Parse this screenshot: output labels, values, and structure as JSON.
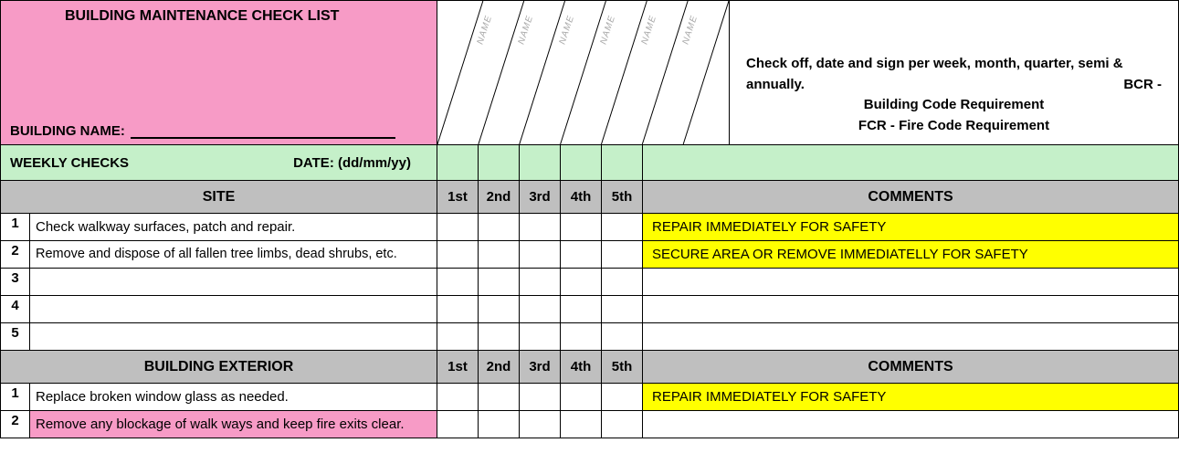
{
  "header": {
    "title": "BUILDING MAINTENANCE CHECK LIST",
    "building_name_label": "BUILDING NAME:",
    "building_name_value": "",
    "name_cols": [
      "NAME",
      "NAME",
      "NAME",
      "NAME",
      "NAME",
      "NAME"
    ],
    "instructions_line1": "Check off, date and sign per week, month, quarter, semi & annually.",
    "instructions_bcr_prefix": "BCR -",
    "instructions_bcr": "Building Code Requirement",
    "instructions_fcr": "FCR - Fire Code Requirement"
  },
  "weekly": {
    "label": "WEEKLY CHECKS",
    "date_label": "DATE: (dd/mm/yy)"
  },
  "columns": {
    "checks": [
      "1st",
      "2nd",
      "3rd",
      "4th",
      "5th"
    ],
    "comments": "COMMENTS"
  },
  "sections": [
    {
      "name": "SITE",
      "rows": [
        {
          "n": "1",
          "desc": "Check walkway surfaces, patch and repair.",
          "comment": "REPAIR IMMEDIATELY FOR SAFETY",
          "hl": "yellow"
        },
        {
          "n": "2",
          "desc": "Remove and dispose of all fallen tree limbs, dead shrubs, etc.",
          "comment": "SECURE AREA OR REMOVE IMMEDIATELLY FOR SAFETY",
          "hl": "yellow"
        },
        {
          "n": "3",
          "desc": "",
          "comment": "",
          "hl": ""
        },
        {
          "n": "4",
          "desc": "",
          "comment": "",
          "hl": ""
        },
        {
          "n": "5",
          "desc": "",
          "comment": "",
          "hl": ""
        }
      ]
    },
    {
      "name": "BUILDING EXTERIOR",
      "rows": [
        {
          "n": "1",
          "desc": "Replace broken window glass as needed.",
          "comment": "REPAIR IMMEDIATELY FOR SAFETY",
          "hl": "yellow",
          "desc_hl": ""
        },
        {
          "n": "2",
          "desc": "Remove any blockage of walk ways and keep fire exits clear.",
          "comment": "",
          "hl": "",
          "desc_hl": "pink"
        }
      ]
    }
  ]
}
